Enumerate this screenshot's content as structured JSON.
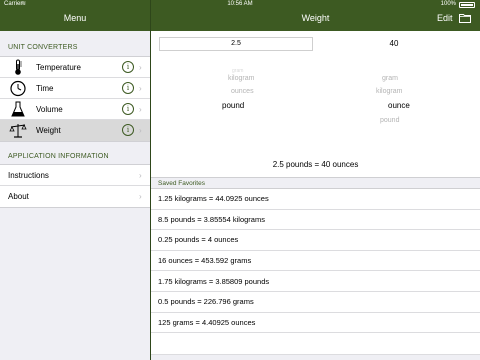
{
  "status": {
    "carrier": "Carrier",
    "time": "10:56 AM",
    "battery": "100%"
  },
  "menu": {
    "title": "Menu"
  },
  "detail": {
    "title": "Weight",
    "edit_label": "Edit"
  },
  "sidebar": {
    "unit_section": "UNIT CONVERTERS",
    "converters": [
      {
        "label": "Temperature",
        "icon": "thermometer-icon"
      },
      {
        "label": "Time",
        "icon": "clock-icon"
      },
      {
        "label": "Volume",
        "icon": "flask-icon"
      },
      {
        "label": "Weight",
        "icon": "scale-icon"
      }
    ],
    "app_section": "APPLICATION INFORMATION",
    "info_items": [
      {
        "label": "Instructions"
      },
      {
        "label": "About"
      }
    ]
  },
  "converter": {
    "input_value": "2.5",
    "result_value": "40",
    "from_units": [
      "gram",
      "kilogram",
      "ounces",
      "pound"
    ],
    "from_selected": "pound",
    "to_units": [
      "gram",
      "kilogram",
      "ounce",
      "pound"
    ],
    "to_selected": "ounce",
    "conversion_text": "2.5 pounds = 40 ounces"
  },
  "favorites": {
    "header": "Saved Favorites",
    "items": [
      "1.25 kilograms = 44.0925 ounces",
      "8.5 pounds = 3.85554 kilograms",
      "0.25 pounds = 4 ounces",
      "16 ounces = 453.592 grams",
      "1.75 kilograms = 3.85809 pounds",
      "0.5 pounds = 226.796 grams",
      "125 grams = 4.40925 ounces"
    ]
  },
  "colors": {
    "accent": "#3d5a22",
    "selected_row": "#d9d9d9",
    "group_bg": "#efeff4"
  }
}
